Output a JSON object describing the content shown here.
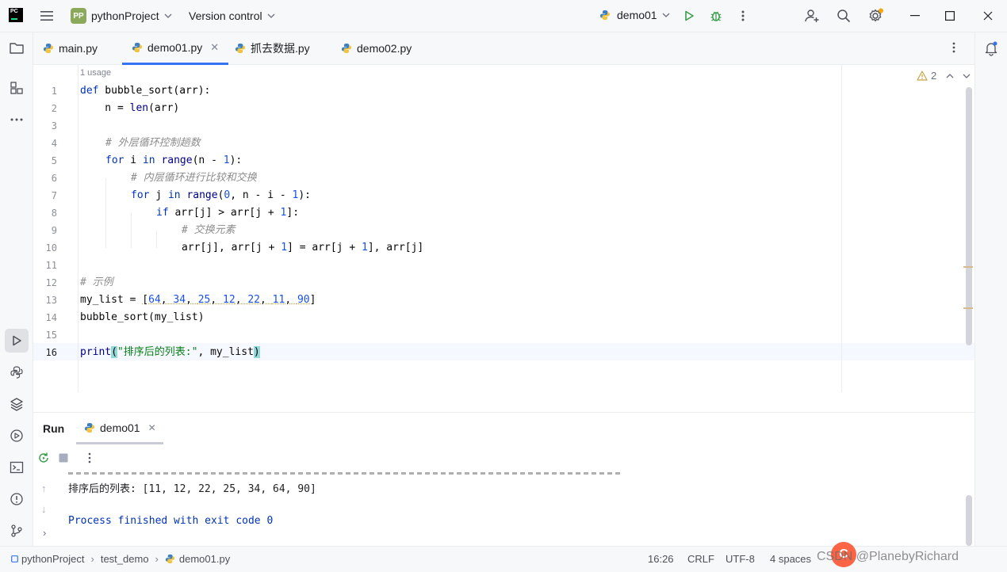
{
  "titlebar": {
    "logo_text": "PC",
    "project_badge": "PP",
    "project_name": "pythonProject",
    "vcs_label": "Version control",
    "run_config": "demo01"
  },
  "tabs": [
    {
      "label": "main.py",
      "active": false
    },
    {
      "label": "demo01.py",
      "active": true
    },
    {
      "label": "抓去数据.py",
      "active": false
    },
    {
      "label": "demo02.py",
      "active": false
    }
  ],
  "editor": {
    "usage_hint": "1 usage",
    "warning_count": "2",
    "line_numbers": [
      "1",
      "2",
      "3",
      "4",
      "5",
      "6",
      "7",
      "8",
      "9",
      "10",
      "11",
      "12",
      "13",
      "14",
      "15",
      "16"
    ],
    "current_line": "16",
    "code": {
      "l1_def": "def",
      "l1_rest": " bubble_sort(arr):",
      "l2_a": "    n = ",
      "l2_len": "len",
      "l2_b": "(arr)",
      "l4_cmt": "# 外层循环控制趟数",
      "l5_for": "for",
      "l5_i": " i ",
      "l5_in": "in",
      "l5_range": " range",
      "l5_a": "(n - ",
      "l5_num": "1",
      "l5_b": "):",
      "l6_cmt": "# 内层循环进行比较和交换",
      "l7_for": "for",
      "l7_j": " j ",
      "l7_in": "in",
      "l7_range": " range",
      "l7_a": "(",
      "l7_n0": "0",
      "l7_b": ", n - i - ",
      "l7_n1": "1",
      "l7_c": "):",
      "l8_if": "if",
      "l8_a": " arr[j] > arr[j + ",
      "l8_n1": "1",
      "l8_b": "]:",
      "l9_cmt": "# 交换元素",
      "l10_a": "arr[j], arr[j + ",
      "l10_n1": "1",
      "l10_b": "] = arr[j + ",
      "l10_n2": "1",
      "l10_c": "], arr[j]",
      "l12_cmt": "# 示例",
      "l13_a": "my_list = ",
      "l13_list_open": "[",
      "l13_values": [
        "64",
        "34",
        "25",
        "12",
        "22",
        "11",
        "90"
      ],
      "l13_list_close": "]",
      "l14": "bubble_sort(my_list)",
      "l16_print": "print",
      "l16_open": "(",
      "l16_str": "\"排序后的列表:\"",
      "l16_b": ", my_list",
      "l16_close": ")"
    }
  },
  "run_panel": {
    "title": "Run",
    "tab_label": "demo01",
    "output_line": "排序后的列表: [11, 12, 22, 25, 34, 64, 90]",
    "exit_line": "Process finished with exit code 0"
  },
  "statusbar": {
    "breadcrumb": [
      "pythonProject",
      "test_demo",
      "demo01.py"
    ],
    "position": "16:26",
    "line_ending": "CRLF",
    "encoding": "UTF-8",
    "indent": "4 spaces",
    "watermark": "CSDN @PlanebyRichard",
    "csdn_logo": "C"
  },
  "colors": {
    "accent": "#3574f0",
    "keyword": "#0033b3",
    "number": "#1750eb",
    "string": "#067d17",
    "comment": "#8c8c8c",
    "run_green": "#3a9d4b"
  },
  "icons": [
    "folder-icon",
    "structure-icon",
    "more-icon",
    "run-tool-icon",
    "python-console-icon",
    "layers-icon",
    "services-icon",
    "terminal-icon",
    "problems-icon",
    "git-icon",
    "notifications-icon",
    "add-user-icon",
    "search-icon",
    "settings-icon",
    "run-icon",
    "debug-icon"
  ]
}
